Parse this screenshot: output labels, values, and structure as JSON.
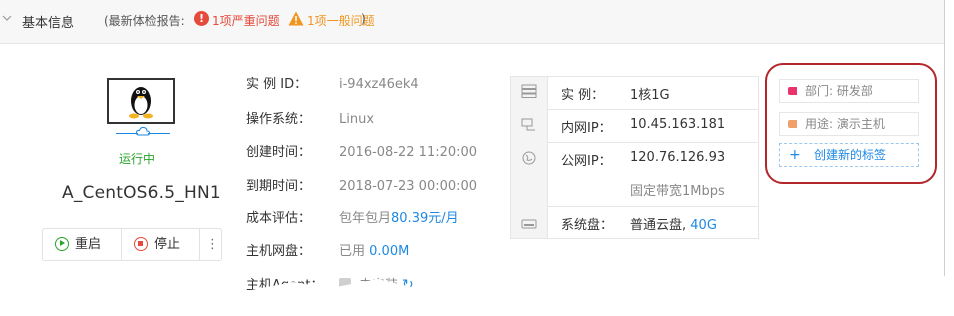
{
  "header": {
    "title": "基本信息",
    "report_prefix": "(最新体检报告:",
    "severe_badge": "!",
    "severe_text": "1项严重问题",
    "general_text": "1项一般问题",
    "report_suffix": ")"
  },
  "host": {
    "status": "运行中",
    "name": "A_CentOS6.5_HN1",
    "actions": {
      "restart": "重启",
      "stop": "停止",
      "more": "⋮"
    }
  },
  "info": {
    "instance_id_label": "实 例 ID：",
    "instance_id": "i-94xz46ek4",
    "os_label": "操作系统：",
    "os": "Linux",
    "created_label": "创建时间：",
    "created": "2016-08-22 11:20:00",
    "expire_label": "到期时间：",
    "expire": "2018-07-23 00:00:00",
    "cost_label": "成本评估：",
    "cost_prefix": "包年包月",
    "cost_value": "80.39元/月",
    "disk_label": "主机网盘：",
    "disk_prefix": "已用",
    "disk_value": "0.00M",
    "agent_label": "主机Agent：",
    "agent_value": "未安装"
  },
  "spec": {
    "instance_label": "实 例：",
    "instance": "1核1G",
    "private_ip_label": "内网IP：",
    "private_ip": "10.45.163.181",
    "public_ip_label": "公网IP：",
    "public_ip": "120.76.126.93",
    "bandwidth": "固定带宽1Mbps",
    "system_disk_label": "系统盘：",
    "system_disk": "普通云盘,",
    "system_disk_size": "40G"
  },
  "tags": {
    "items": [
      {
        "label": "部门: 研发部",
        "color": "#e8336d"
      },
      {
        "label": "用途: 演示主机",
        "color": "#f0a06a"
      }
    ],
    "create_label": "创建新的标签"
  },
  "colors": {
    "accent": "#1e88e5",
    "running": "#2aa52a",
    "danger": "#e64a3b",
    "warning": "#f0951e",
    "highlight": "#b3262a"
  }
}
